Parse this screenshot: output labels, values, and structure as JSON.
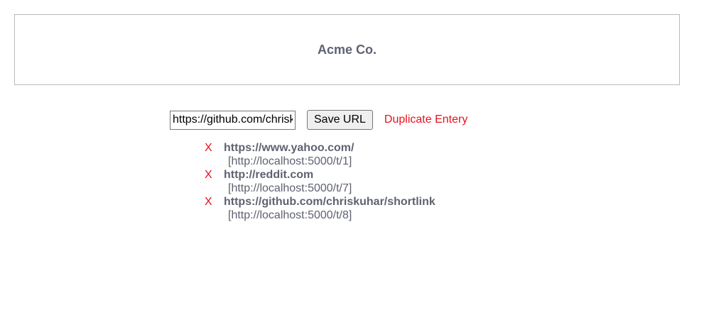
{
  "header": {
    "title": "Acme Co."
  },
  "form": {
    "url_value": "https://github.com/chriskuhar/shortlink",
    "save_label": "Save URL",
    "error_message": "Duplicate Entery"
  },
  "links": [
    {
      "delete_label": "X",
      "original": "https://www.yahoo.com/",
      "short": "[http://localhost:5000/t/1]"
    },
    {
      "delete_label": "X",
      "original": "http://reddit.com",
      "short": "[http://localhost:5000/t/7]"
    },
    {
      "delete_label": "X",
      "original": "https://github.com/chriskuhar/shortlink",
      "short": "[http://localhost:5000/t/8]"
    }
  ],
  "colors": {
    "text_gray": "#5f6270",
    "error_red": "#e8101d",
    "border_gray": "#b8b8bd"
  }
}
